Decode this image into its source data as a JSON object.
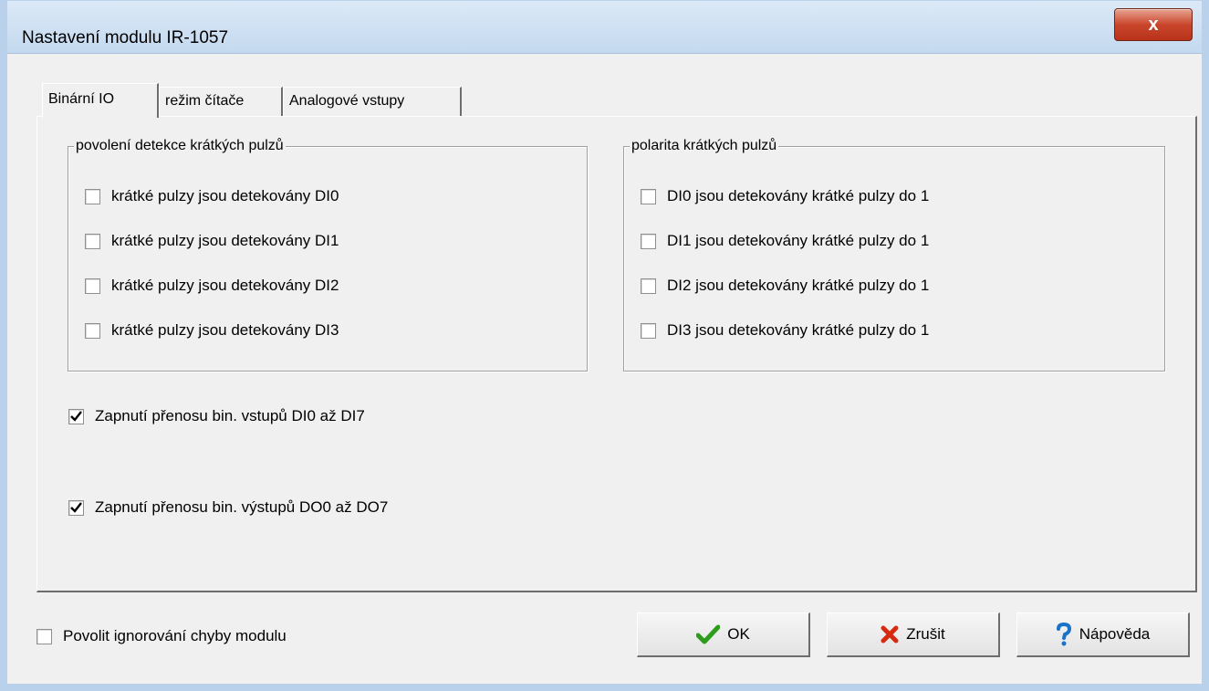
{
  "window": {
    "title": "Nastavení modulu IR-1057",
    "close_label": "x"
  },
  "tabs": [
    {
      "label": "Binární IO",
      "active": true
    },
    {
      "label": "režim čítače",
      "active": false
    },
    {
      "label": "Analogové vstupy",
      "active": false
    }
  ],
  "detection_group": {
    "legend": "povolení detekce krátkých pulzů",
    "items": [
      {
        "label": "krátké pulzy jsou detekovány DI0",
        "checked": false
      },
      {
        "label": "krátké pulzy jsou detekovány DI1",
        "checked": false
      },
      {
        "label": "krátké pulzy jsou detekovány DI2",
        "checked": false
      },
      {
        "label": "krátké pulzy jsou detekovány DI3",
        "checked": false
      }
    ]
  },
  "polarity_group": {
    "legend": "polarita krátkých pulzů",
    "items": [
      {
        "label": "DI0 jsou detekovány krátké pulzy do 1",
        "checked": false
      },
      {
        "label": "DI1 jsou detekovány krátké pulzy do 1",
        "checked": false
      },
      {
        "label": "DI2 jsou detekovány krátké pulzy do 1",
        "checked": false
      },
      {
        "label": "DI3 jsou detekovány krátké pulzy do 1",
        "checked": false
      }
    ]
  },
  "transfer": {
    "inputs_label": "Zapnutí přenosu bin. vstupů DI0 až DI7",
    "inputs_checked": true,
    "outputs_label": "Zapnutí přenosu bin. výstupů DO0 až DO7",
    "outputs_checked": true
  },
  "footer": {
    "ignore_errors_label": "Povolit ignorování chyby modulu",
    "ignore_errors_checked": false,
    "ok_label": "OK",
    "cancel_label": "Zrušit",
    "help_label": "Nápověda"
  },
  "colors": {
    "ok_check": "#2e9c1c",
    "cancel_x": "#d62b10",
    "help_mark": "#1a73c9"
  }
}
